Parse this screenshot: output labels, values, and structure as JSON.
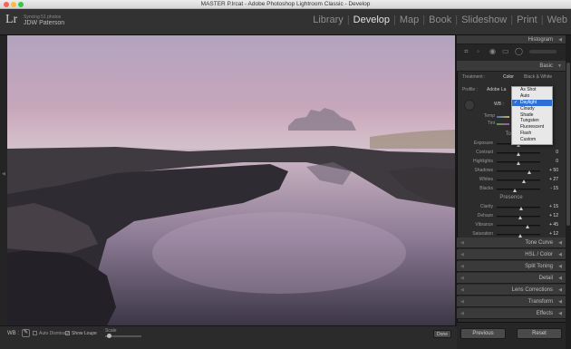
{
  "window": {
    "title": "MASTER P.lrcat - Adobe Photoshop Lightroom Classic - Develop"
  },
  "identity": {
    "logo": "Lr",
    "sync_status": "Syncing 51 photos",
    "user": "JDW Paterson"
  },
  "modules": [
    "Library",
    "Develop",
    "Map",
    "Book",
    "Slideshow",
    "Print",
    "Web"
  ],
  "active_module": "Develop",
  "panels": {
    "histogram": "Histogram",
    "basic": "Basic",
    "treatment_label": "Treatment :",
    "treatment_color": "Color",
    "treatment_bw": "Black & White",
    "profile_label": "Profile :",
    "profile_value": "Adobe La",
    "wb_label": "WB :",
    "temp_label": "Temp",
    "tint_label": "Tint",
    "tone_label": "Tone",
    "presence_label": "Presence",
    "tone_curve": "Tone Curve",
    "hsl": "HSL / Color",
    "split_toning": "Split Toning",
    "detail": "Detail",
    "lens_corrections": "Lens Corrections",
    "transform": "Transform",
    "effects": "Effects"
  },
  "wb_options": [
    "As Shot",
    "Auto",
    "Daylight",
    "Cloudy",
    "Shade",
    "Tungsten",
    "Fluorescent",
    "Flash",
    "Custom"
  ],
  "wb_selected": "Daylight",
  "tone_sliders": [
    {
      "label": "Exposure",
      "value": "",
      "pos": 0.5
    },
    {
      "label": "Contrast",
      "value": "0",
      "pos": 0.5
    },
    {
      "label": "Highlights",
      "value": "0",
      "pos": 0.5
    },
    {
      "label": "Shadows",
      "value": "+ 50",
      "pos": 0.75
    },
    {
      "label": "Whites",
      "value": "+ 27",
      "pos": 0.63
    },
    {
      "label": "Blacks",
      "value": "- 15",
      "pos": 0.43
    }
  ],
  "presence_sliders": [
    {
      "label": "Clarity",
      "value": "+ 15",
      "pos": 0.58
    },
    {
      "label": "Dehaze",
      "value": "+ 12",
      "pos": 0.56
    },
    {
      "label": "Vibrance",
      "value": "+ 45",
      "pos": 0.72
    },
    {
      "label": "Saturation",
      "value": "+ 12",
      "pos": 0.56
    }
  ],
  "toolbar": {
    "wb": "WB :",
    "auto_dismiss": "Auto Dismiss",
    "show_loupe": "Show Loupe",
    "scale": "Scale",
    "done": "Done"
  },
  "buttons": {
    "previous": "Previous",
    "reset": "Reset"
  }
}
